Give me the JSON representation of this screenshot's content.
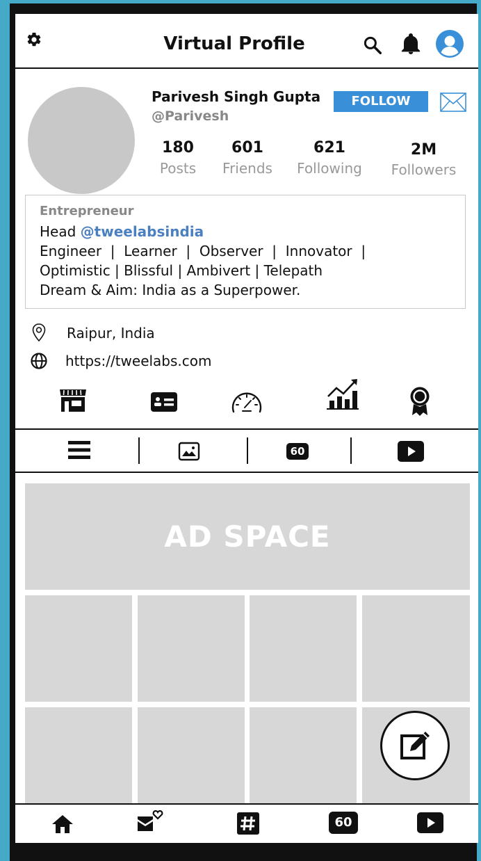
{
  "header": {
    "title": "Virtual Profile",
    "icons": [
      "gear-icon",
      "search-icon",
      "bell-icon",
      "user-avatar-icon"
    ]
  },
  "profile": {
    "name": "Parivesh Singh Gupta",
    "handle": "@Parivesh",
    "follow_label": "FOLLOW",
    "stats": [
      {
        "value": "180",
        "label": "Posts"
      },
      {
        "value": "601",
        "label": "Friends"
      },
      {
        "value": "621",
        "label": "Following"
      },
      {
        "value": "2M",
        "label": "Followers"
      }
    ]
  },
  "bio": {
    "title": "Entrepreneur",
    "head_prefix": "Head",
    "head_link": "@tweelabsindia",
    "line2": "Engineer  |  Learner  |  Observer  |  Innovator  |",
    "line3": "Optimistic | Blissful | Ambivert | Telepath",
    "line4": "Dream & Aim: India as a Superpower."
  },
  "info": {
    "location": "Raipur, India",
    "website": "https://tweelabs.com"
  },
  "tabs": {
    "video60_label": "60"
  },
  "feed": {
    "ad_label": "AD SPACE"
  },
  "bottom_nav": {
    "video60_label": "60"
  },
  "colors": {
    "accent": "#3a8fd9",
    "link": "#4a7fc0",
    "frame": "#45a9c8",
    "tile": "#d7d7d7"
  }
}
